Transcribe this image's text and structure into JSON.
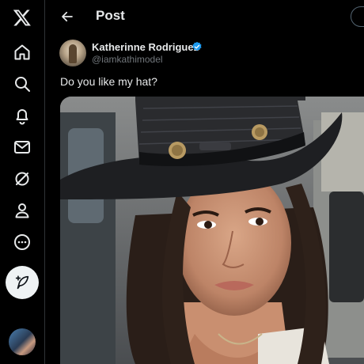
{
  "app": "X",
  "sidebar": {
    "items": [
      {
        "icon": "x-logo-icon",
        "label": "X"
      },
      {
        "icon": "home-icon",
        "label": "Home"
      },
      {
        "icon": "search-icon",
        "label": "Explore"
      },
      {
        "icon": "bell-icon",
        "label": "Notifications"
      },
      {
        "icon": "mail-icon",
        "label": "Messages"
      },
      {
        "icon": "grok-icon",
        "label": "Grok"
      },
      {
        "icon": "profile-icon",
        "label": "Profile"
      },
      {
        "icon": "more-icon",
        "label": "More"
      }
    ],
    "compose": {
      "icon": "compose-feather-icon"
    }
  },
  "header": {
    "title": "Post"
  },
  "post": {
    "author_name": "Katherinne Rodriguez",
    "author_handle": "@iamkathimodel",
    "verified": true,
    "text": "Do you like my hat?",
    "media": {
      "type": "photo"
    }
  },
  "colors": {
    "background": "#000000",
    "text": "#e7e9ea",
    "muted": "#71767b",
    "verified": "#1d9bf0",
    "compose_bg": "#eff3f4"
  }
}
